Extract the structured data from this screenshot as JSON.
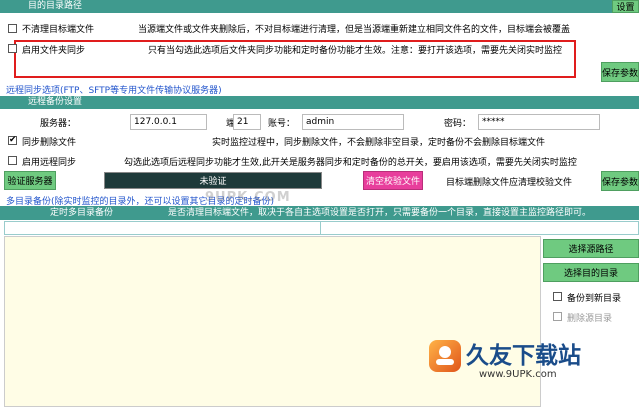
{
  "target": {
    "header": "目的目录路径",
    "settings_btn": "设置",
    "no_clean_label": "不清理目标端文件",
    "no_clean_desc": "当源端文件或文件夹删除后，不对目标端进行清理，但是当源端重新建立相同文件名的文件，目标端会被覆盖",
    "sync_folder_label": "启用文件夹同步",
    "sync_folder_desc": "只有当勾选此选项后文件夹同步功能和定时备份功能才生效。注意：要打开该选项，需要先关闭实时监控",
    "save_btn": "保存参数"
  },
  "remote": {
    "section_link": "远程同步选项(FTP、SFTP等专用文件传输协议服务器)",
    "header": "远程备份设置",
    "server_label": "服务器：",
    "server_value": "127.0.0.1",
    "port_label": "端口：",
    "port_value": "21",
    "account_label": "账号：",
    "account_value": "admin",
    "password_label": "密码：",
    "password_value": "*****",
    "sync_delete_label": "同步删除文件",
    "sync_delete_desc": "实时监控过程中，同步删除文件，不会删除非空目录，定时备份不会删除目标端文件",
    "remote_sync_label": "启用远程同步",
    "remote_sync_desc": "勾选此选项后远程同步功能才生效,此开关是服务器同步和定时备份的总开关，要启用该选项，需要先关闭实时监控",
    "verify_btn": "验证服务器",
    "unverified": "未验证",
    "clear_btn": "清空校验文件",
    "remote_delete_label": "目标端删除文件应清理校验文件",
    "save_btn": "保存参数"
  },
  "multi": {
    "section_link": "多目录备份(除实时监控的目录外，还可以设置其它目录的定时备份)",
    "header": "定时多目录备份",
    "header_desc": "是否清理目标端文件，取决于各自主选项设置是否打开，只需要备份一个目录，直接设置主监控路径即可。",
    "select_source_btn": "选择源路径",
    "select_target_btn": "选择目的目录",
    "backup_new_dir_label": "备份到新目录",
    "delete_source_label": "删除源目录"
  },
  "watermark": {
    "top": "9UPK.COM",
    "brand": "久友下载站",
    "url": "www.9UPK.com"
  },
  "colors": {
    "teal": "#3f9a8e",
    "green_button": "#6fca80",
    "pink_button": "#e83e9c",
    "unverified_bar": "#1e3a3a",
    "red_highlight": "#e01d1d",
    "list_bg": "#fffde6"
  }
}
